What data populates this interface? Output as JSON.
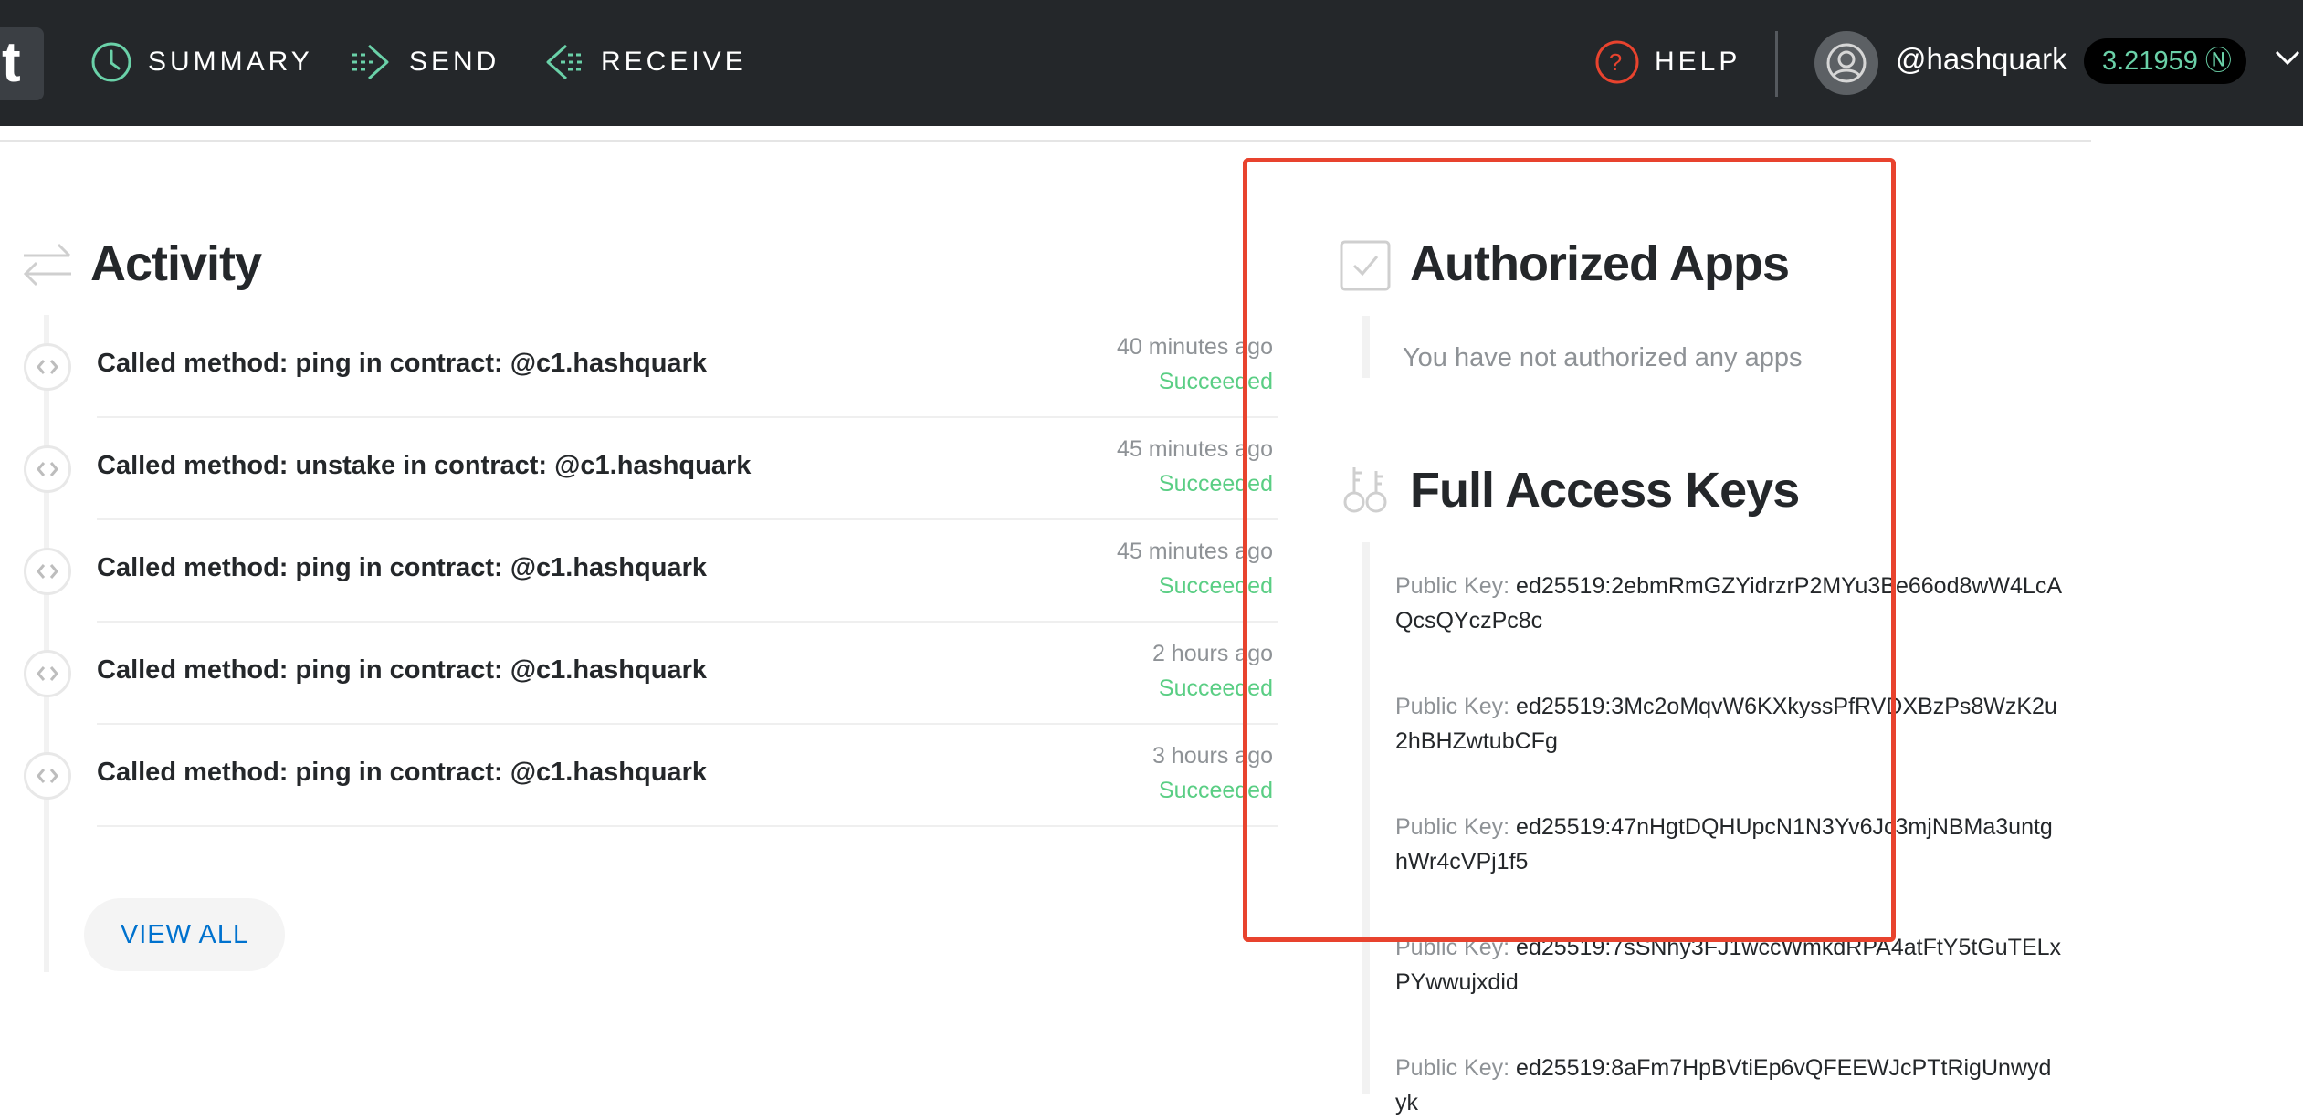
{
  "nav": {
    "logo_char": "t",
    "summary": "SUMMARY",
    "send": "SEND",
    "receive": "RECEIVE",
    "help": "HELP",
    "account": "@hashquark",
    "balance": "3.21959 Ⓝ"
  },
  "activity": {
    "title": "Activity",
    "items": [
      {
        "text": "Called method: ping in contract: @c1.hashquark",
        "time": "40 minutes ago",
        "status": "Succeeded"
      },
      {
        "text": "Called method: unstake in contract: @c1.hashquark",
        "time": "45 minutes ago",
        "status": "Succeeded"
      },
      {
        "text": "Called method: ping in contract: @c1.hashquark",
        "time": "45 minutes ago",
        "status": "Succeeded"
      },
      {
        "text": "Called method: ping in contract: @c1.hashquark",
        "time": "2 hours ago",
        "status": "Succeeded"
      },
      {
        "text": "Called method: ping in contract: @c1.hashquark",
        "time": "3 hours ago",
        "status": "Succeeded"
      }
    ],
    "view_all": "VIEW ALL"
  },
  "authorized_apps": {
    "title": "Authorized Apps",
    "empty_text": "You have not authorized any apps"
  },
  "full_access_keys": {
    "title": "Full Access Keys",
    "label": "Public Key:",
    "keys": [
      "ed25519:2ebmRmGZYidrzrP2MYu3Be66od8wW4LcAQcsQYczPc8c",
      "ed25519:3Mc2oMqvW6KXkyssPfRVDXBzPs8WzK2u2hBHZwtubCFg",
      "ed25519:47nHgtDQHUpcN1N3Yv6Jc3mjNBMa3untghWr4cVPj1f5",
      "ed25519:7sSNhy3FJ1wccWmkdRPA4atFtY5tGuTELxPYwwujxdid",
      "ed25519:8aFm7HpBVtiEp6vQFEEWJcPTtRigUnwydyk"
    ]
  },
  "colors": {
    "navbar": "#24272a",
    "accent_green": "#6ad1a8",
    "success": "#5ace84",
    "link_blue": "#0072ce",
    "help_red": "#e8432e",
    "highlight_red": "#e8432e"
  }
}
